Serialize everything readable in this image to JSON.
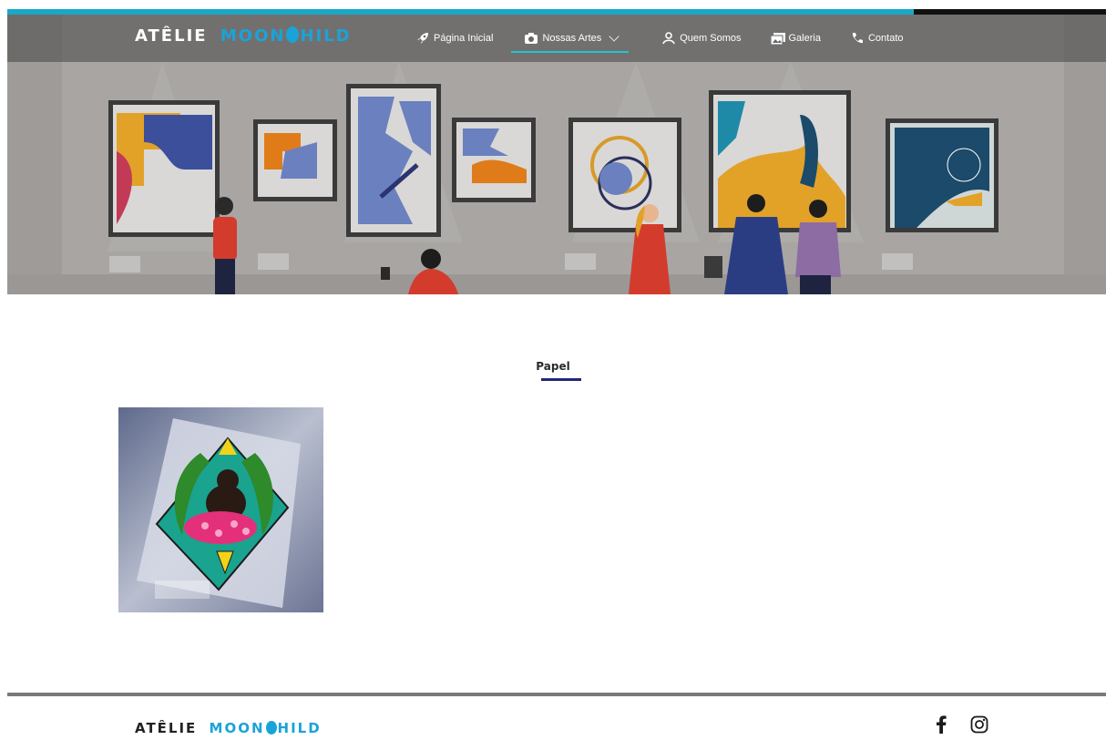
{
  "progress": {
    "fraction": 0.825,
    "color": "#19a8c7"
  },
  "brand": {
    "first": "ATÊLIE",
    "second_a": "MOON",
    "second_b": "HILD",
    "accent": "#1aa3d8"
  },
  "nav": {
    "items": [
      {
        "label": "Página Inicial",
        "icon": "rocket-icon"
      },
      {
        "label": "Nossas Artes",
        "icon": "camera-icon",
        "active": true,
        "dropdown": true
      },
      {
        "label": "Quem Somos",
        "icon": "users-icon"
      },
      {
        "label": "Galeria",
        "icon": "images-icon"
      },
      {
        "label": "Contato",
        "icon": "phone-icon"
      }
    ]
  },
  "category": {
    "title": "Papel",
    "underline_color": "#23267a"
  },
  "footer": {
    "brand": {
      "first": "ATÊLIE",
      "second_a": "MOON",
      "second_b": "HILD"
    },
    "social": [
      {
        "icon": "facebook-icon"
      },
      {
        "icon": "instagram-icon"
      }
    ]
  }
}
